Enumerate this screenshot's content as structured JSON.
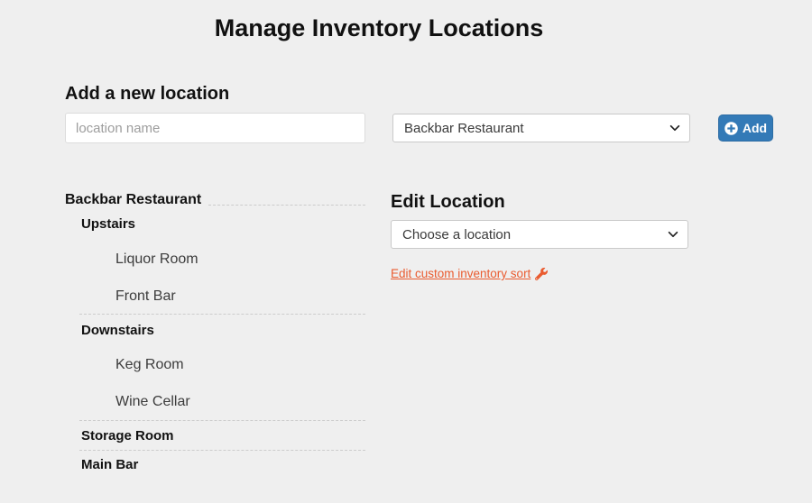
{
  "page": {
    "title": "Manage Inventory Locations",
    "background_color": "#efefef",
    "accent_blue": "#337ab7",
    "accent_orange": "#ea5b2f"
  },
  "add_section": {
    "heading": "Add a new location",
    "name_input": {
      "value": "",
      "placeholder": "location name"
    },
    "parent_select": {
      "selected": "Backbar Restaurant",
      "icon": "chevron-down-icon"
    },
    "add_button": {
      "label": "Add",
      "icon": "plus-circle-icon"
    }
  },
  "locations_tree": {
    "root": "Backbar Restaurant",
    "groups": [
      {
        "name": "Upstairs",
        "rooms": [
          "Liquor Room",
          "Front Bar"
        ]
      },
      {
        "name": "Downstairs",
        "rooms": [
          "Keg Room",
          "Wine Cellar"
        ]
      },
      {
        "name": "Storage Room",
        "rooms": []
      },
      {
        "name": "Main Bar",
        "rooms": []
      }
    ]
  },
  "edit_section": {
    "heading": "Edit Location",
    "location_select": {
      "selected": "Choose a location",
      "icon": "chevron-down-icon"
    },
    "custom_sort_link": {
      "label": "Edit custom inventory sort",
      "icon": "wrench-icon"
    }
  }
}
